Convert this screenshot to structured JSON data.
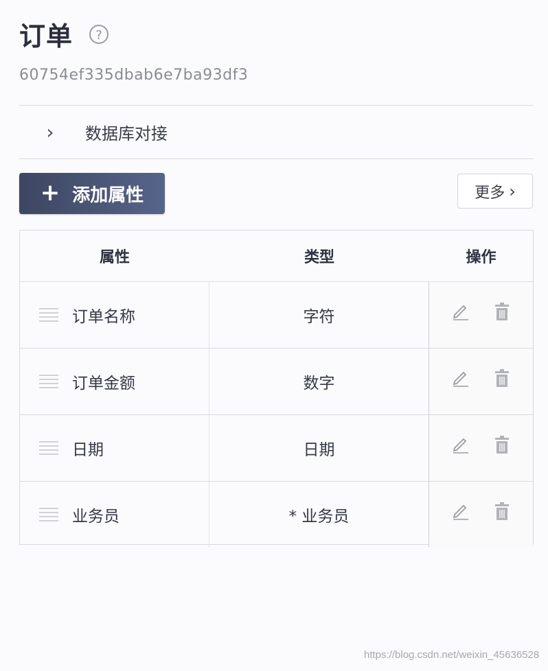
{
  "header": {
    "title": "订单",
    "help_icon": "?",
    "record_id": "60754ef335dbab6e7ba93df3"
  },
  "section": {
    "chevron": "›",
    "label": "数据库对接"
  },
  "toolbar": {
    "add_plus": "+",
    "add_label": "添加属性",
    "more_label": "更多",
    "more_arrow": "›"
  },
  "table": {
    "columns": [
      "属性",
      "类型",
      "操作"
    ],
    "rows": [
      {
        "name": "订单名称",
        "type": "字符"
      },
      {
        "name": "订单金额",
        "type": "数字"
      },
      {
        "name": "日期",
        "type": "日期"
      },
      {
        "name": "业务员",
        "type": "* 业务员"
      }
    ]
  },
  "watermark": "https://blog.csdn.net/weixin_45636528",
  "colors": {
    "primary_button": "#4a5575",
    "border": "#d6d7dd",
    "icon": "#aaaaaf"
  }
}
